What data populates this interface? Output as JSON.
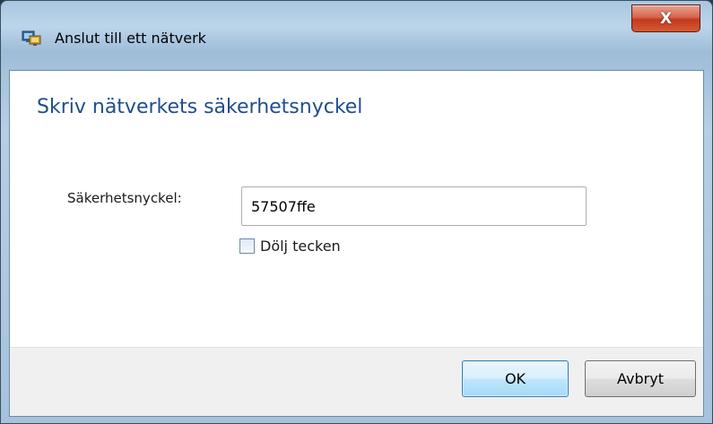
{
  "window": {
    "title": "Anslut till ett nätverk",
    "close_symbol": "X"
  },
  "dialog": {
    "heading": "Skriv nätverkets säkerhetsnyckel",
    "key_label": "Säkerhetsnyckel:",
    "key_value": "57507ffe",
    "hide_chars_label": "Dölj tecken",
    "hide_chars_checked": false
  },
  "buttons": {
    "ok_label": "OK",
    "cancel_label": "Avbryt"
  },
  "icons": {
    "app": "network-connect-icon",
    "close": "close-icon"
  },
  "colors": {
    "heading": "#1f4e8c",
    "close_button": "#c23a1c"
  }
}
